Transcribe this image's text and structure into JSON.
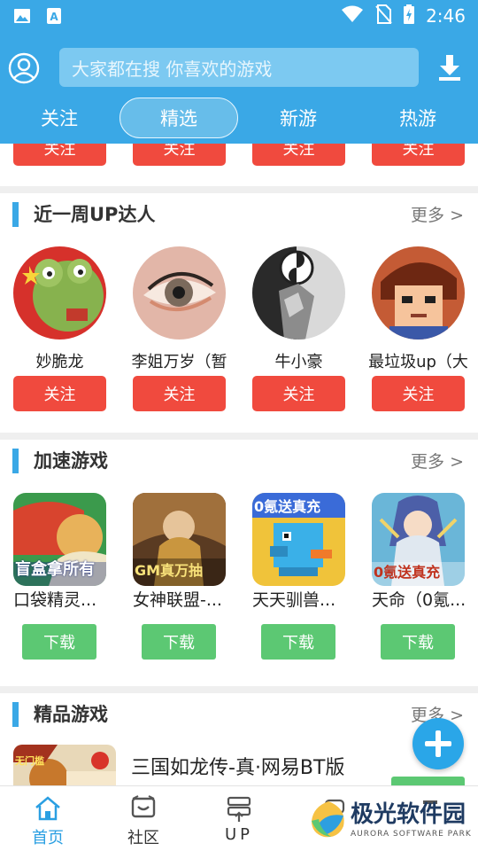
{
  "status_bar": {
    "time": "2:46"
  },
  "header": {
    "search_placeholder": "大家都在搜  你喜欢的游戏",
    "tabs": [
      "关注",
      "精选",
      "新游",
      "热游"
    ],
    "active_tab": "精选"
  },
  "top_strip": {
    "follow_label": "关注"
  },
  "up_section": {
    "title": "近一周UP达人",
    "more": "更多 >",
    "users": [
      {
        "name": "妙脆龙",
        "follow": "关注"
      },
      {
        "name": "李姐万岁（暂",
        "follow": "关注"
      },
      {
        "name": "牛小豪",
        "follow": "关注"
      },
      {
        "name": "最垃圾up（大",
        "follow": "关注"
      }
    ]
  },
  "speed_section": {
    "title": "加速游戏",
    "more": "更多 >",
    "games": [
      {
        "name": "口袋精灵...",
        "download": "下载",
        "icon_text": "盲盒拿所有"
      },
      {
        "name": "女神联盟-...",
        "download": "下载",
        "icon_text": "GM真万抽"
      },
      {
        "name": "天天驯兽...",
        "download": "下载",
        "icon_text": "0氪送真充"
      },
      {
        "name": "天命（0氪...",
        "download": "下载",
        "icon_text": "0氪送真充"
      }
    ]
  },
  "premium_section": {
    "title": "精品游戏",
    "more": "更多 >",
    "game": {
      "name": "三国如龙传-真·网易BT版",
      "icon_text": "无门槛"
    }
  },
  "bottom_nav": {
    "items": [
      {
        "label": "首页",
        "icon": "home-icon"
      },
      {
        "label": "社区",
        "icon": "community-icon"
      },
      {
        "label": "UP",
        "icon": "up-icon"
      },
      {
        "label": "",
        "icon": "game-icon"
      },
      {
        "label": "",
        "icon": "profile-icon"
      }
    ]
  },
  "watermark": {
    "text": "极光软件园",
    "sub": "AURORA SOFTWARE PARK"
  },
  "colors": {
    "primary": "#3aa8e6",
    "follow": "#f04a3e",
    "download": "#5cc873"
  }
}
